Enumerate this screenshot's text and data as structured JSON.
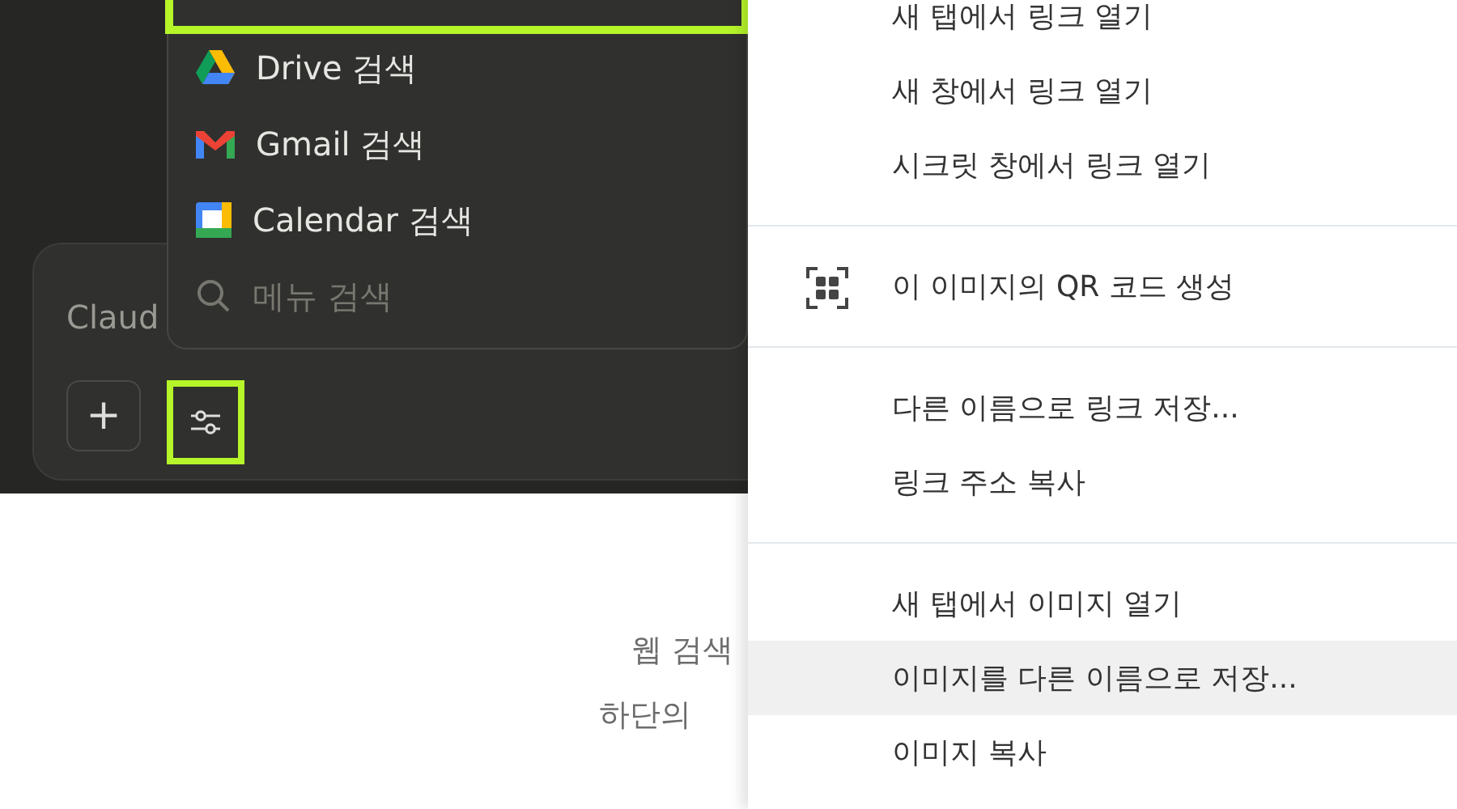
{
  "left_panel": {
    "menu": {
      "items": [
        {
          "kind": "drive",
          "label": "Drive 검색"
        },
        {
          "kind": "gmail",
          "label": "Gmail 검색"
        },
        {
          "kind": "calendar",
          "label": "Calendar 검색"
        },
        {
          "kind": "search",
          "placeholder": "메뉴 검색"
        }
      ]
    },
    "composer": {
      "placeholder": "Claud",
      "buttons": [
        {
          "kind": "add",
          "label": "+",
          "highlighted": false
        },
        {
          "kind": "tools",
          "highlighted": true
        }
      ]
    }
  },
  "page_text": [
    "웹 검색",
    "하단의"
  ],
  "context_menu": {
    "groups": [
      {
        "items": [
          {
            "label": "새 탭에서 링크 열기",
            "hovered": false
          },
          {
            "label": "새 창에서 링크 열기",
            "hovered": false
          },
          {
            "label": "시크릿 창에서 링크 열기",
            "hovered": false
          }
        ]
      },
      {
        "items": [
          {
            "label": "이 이미지의 QR 코드 생성",
            "kind": "qr",
            "hovered": false
          }
        ]
      },
      {
        "items": [
          {
            "label": "다른 이름으로 링크 저장...",
            "hovered": false
          },
          {
            "label": "링크 주소 복사",
            "hovered": false
          }
        ]
      },
      {
        "items": [
          {
            "label": "새 탭에서 이미지 열기",
            "hovered": false
          },
          {
            "label": "이미지를 다른 이름으로 저장...",
            "hovered": true
          },
          {
            "label": "이미지 복사",
            "hovered": false
          }
        ]
      }
    ]
  }
}
